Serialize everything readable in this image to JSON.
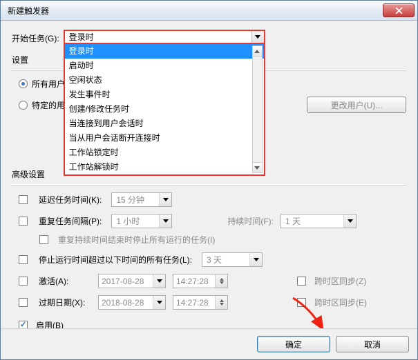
{
  "window": {
    "title": "新建触发器"
  },
  "start_task": {
    "label": "开始任务(G):",
    "selected": "登录时",
    "options": [
      "登录时",
      "启动时",
      "空闲状态",
      "发生事件时",
      "创建/修改任务时",
      "当连接到用户会话时",
      "当从用户会话断开连接时",
      "工作站锁定时",
      "工作站解锁时"
    ]
  },
  "settings": {
    "title": "设置",
    "all_users": "所有用户",
    "specific_user": "特定的用户",
    "change_user_btn": "更改用户(U)..."
  },
  "advanced": {
    "title": "高级设置",
    "delay_task": {
      "label": "延迟任务时间(K):",
      "value": "15 分钟"
    },
    "repeat": {
      "label": "重复任务间隔(P):",
      "value": "1 小时",
      "duration_label": "持续时间(F):",
      "duration_value": "1 天",
      "stop_at_end": "重复持续时间结束时停止所有运行的任务(I)"
    },
    "stop_after": {
      "label": "停止运行时间超过以下时间的所有任务(L):",
      "value": "3 天"
    },
    "activate": {
      "label": "激活(A):",
      "date": "2017-08-28",
      "time": "14:27:28",
      "tz_sync": "跨时区同步(Z)"
    },
    "expire": {
      "label": "过期日期(X):",
      "date": "2018-08-28",
      "time": "14:27:28",
      "tz_sync": "跨时区同步(E)"
    },
    "enabled": "启用(B)"
  },
  "buttons": {
    "ok": "确定",
    "cancel": "取消"
  }
}
